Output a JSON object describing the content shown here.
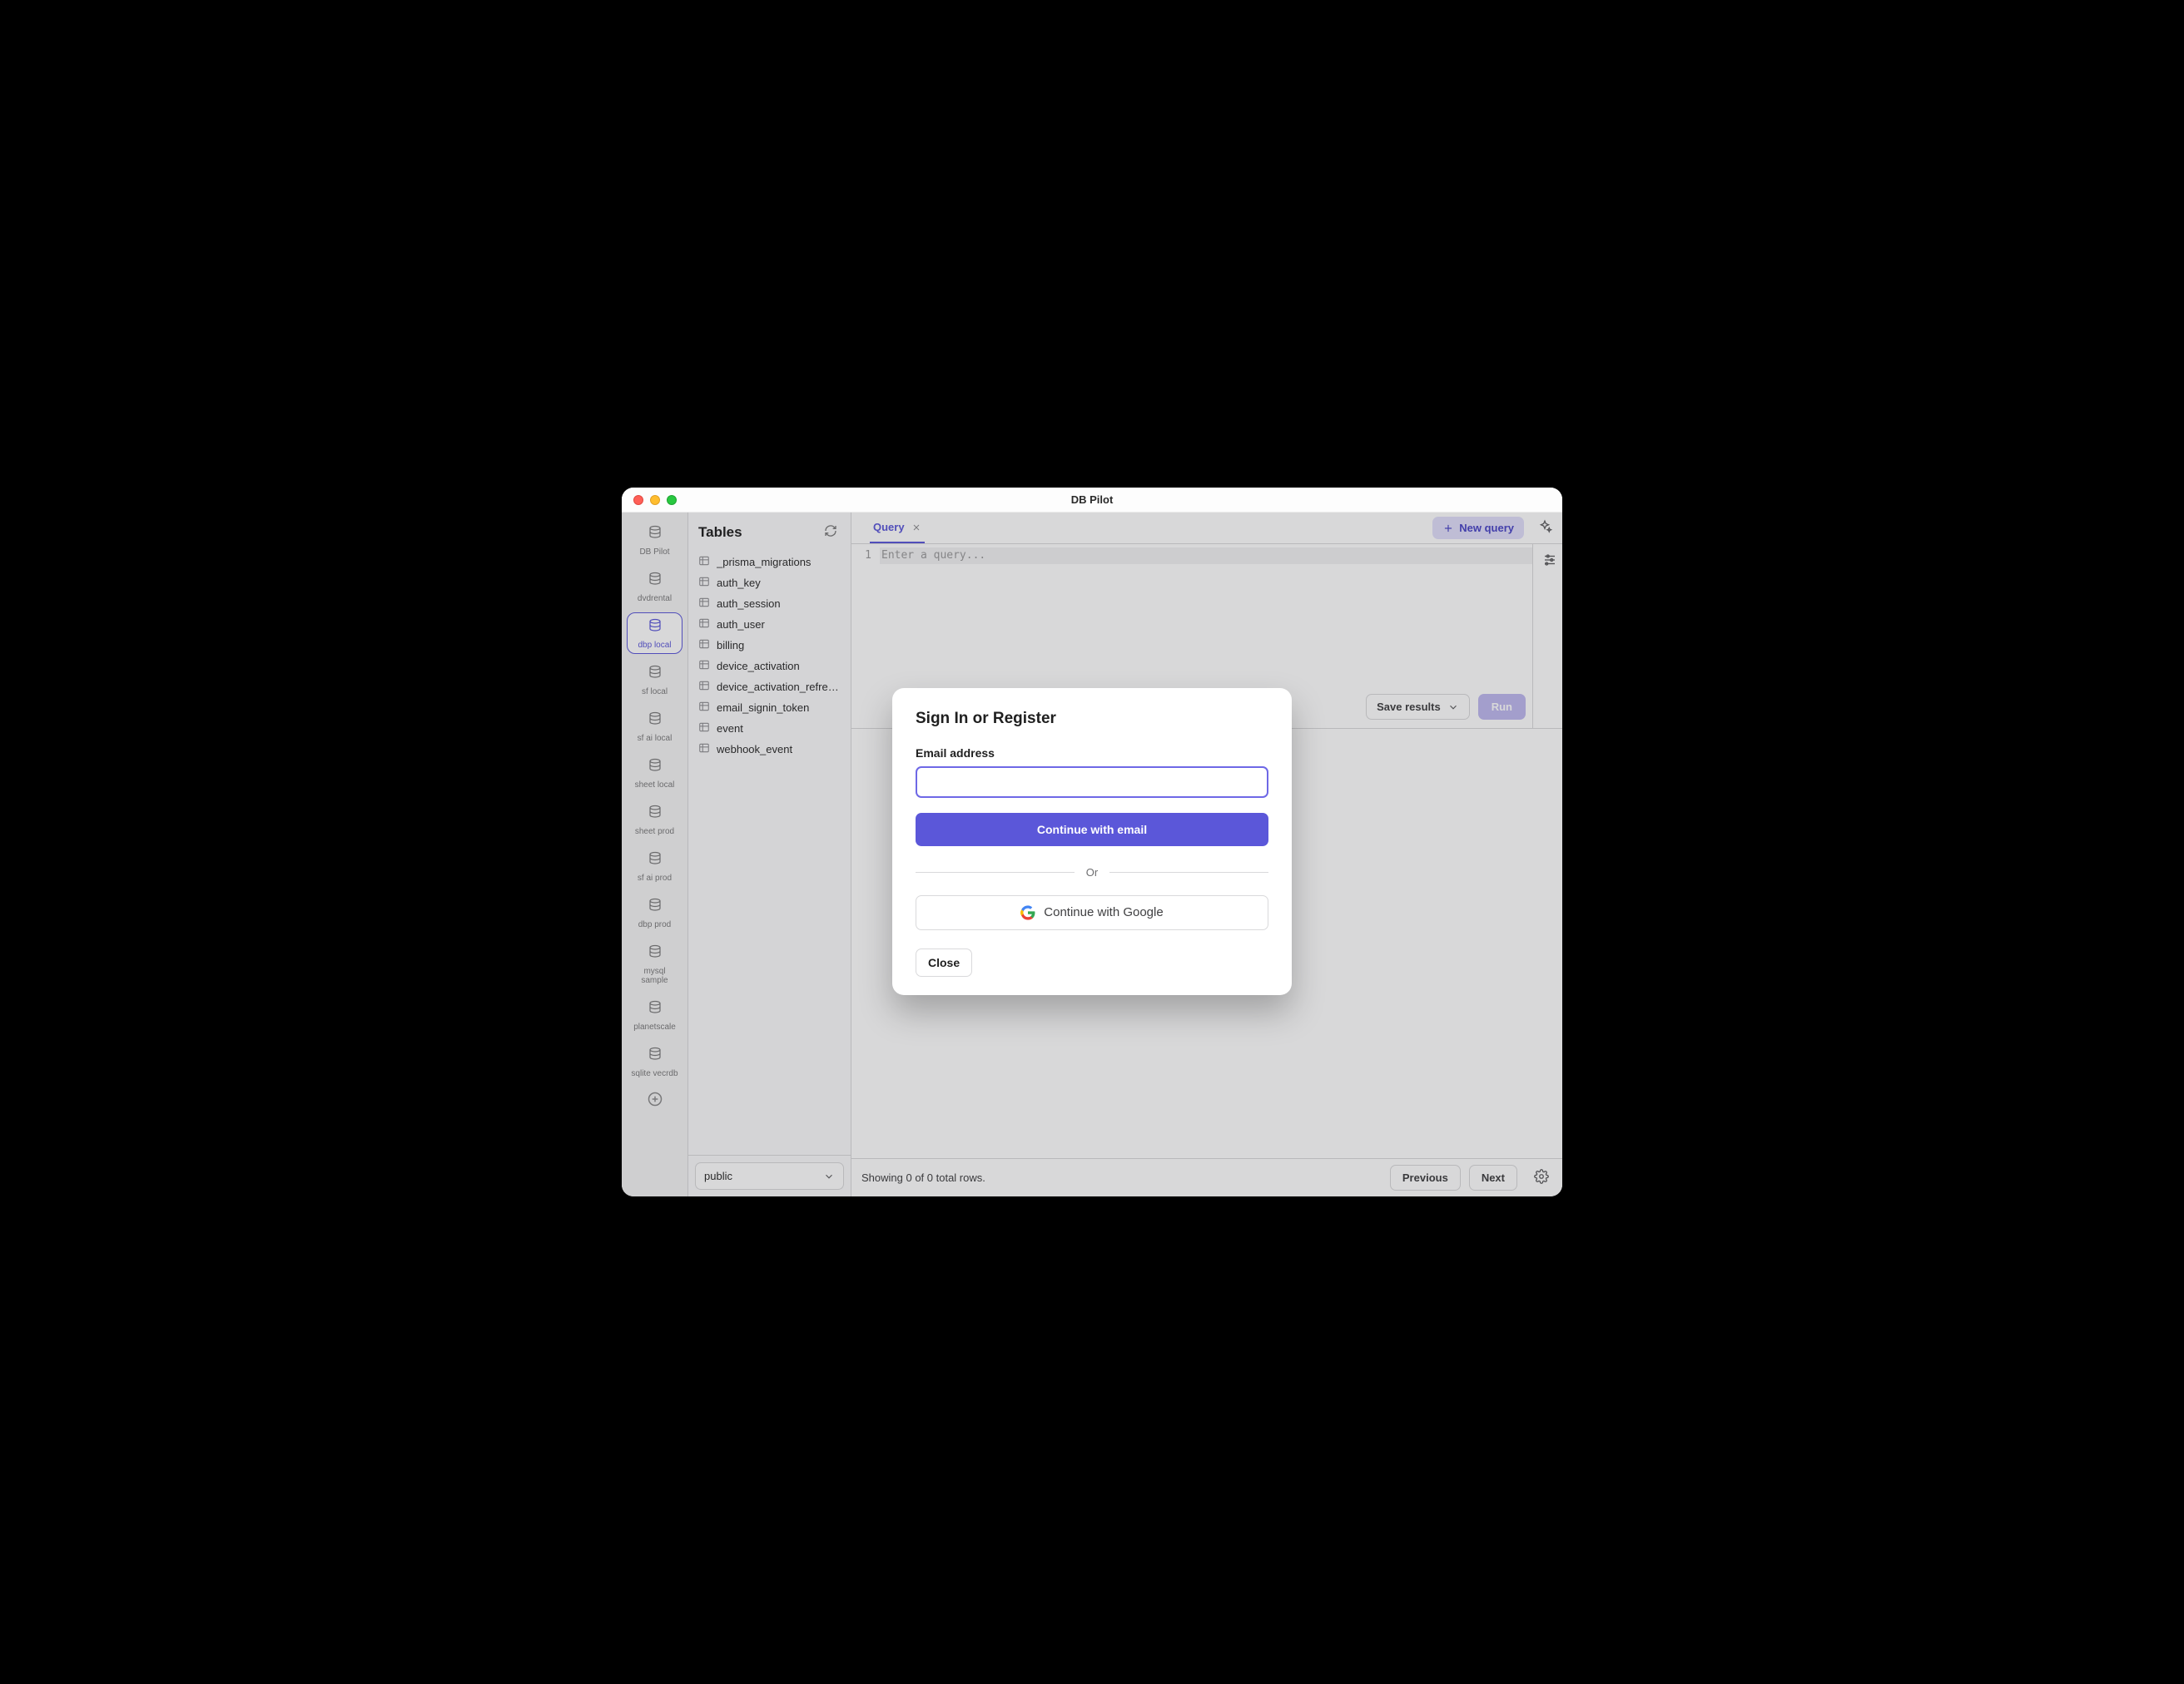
{
  "window": {
    "title": "DB Pilot"
  },
  "rail": {
    "items": [
      {
        "label": "DB Pilot",
        "active": false
      },
      {
        "label": "dvdrental",
        "active": false
      },
      {
        "label": "dbp local",
        "active": true
      },
      {
        "label": "sf local",
        "active": false
      },
      {
        "label": "sf ai local",
        "active": false
      },
      {
        "label": "sheet local",
        "active": false
      },
      {
        "label": "sheet prod",
        "active": false
      },
      {
        "label": "sf ai prod",
        "active": false
      },
      {
        "label": "dbp prod",
        "active": false
      },
      {
        "label": "mysql sample",
        "active": false
      },
      {
        "label": "planetscale",
        "active": false
      },
      {
        "label": "sqlite vecrdb",
        "active": false
      }
    ]
  },
  "sidebar": {
    "heading": "Tables",
    "tables": [
      "_prisma_migrations",
      "auth_key",
      "auth_session",
      "auth_user",
      "billing",
      "device_activation",
      "device_activation_refresh…",
      "email_signin_token",
      "event",
      "webhook_event"
    ],
    "schema_selected": "public"
  },
  "tabs": {
    "active_label": "Query",
    "new_query_label": "New query"
  },
  "editor": {
    "line_number": "1",
    "placeholder": "Enter a query..."
  },
  "actions": {
    "save_results_label": "Save results",
    "run_label": "Run"
  },
  "footer": {
    "status": "Showing 0 of 0 total rows.",
    "prev_label": "Previous",
    "next_label": "Next"
  },
  "modal": {
    "title": "Sign In or Register",
    "email_label": "Email address",
    "email_value": "",
    "continue_email": "Continue with email",
    "or": "Or",
    "continue_google": "Continue with Google",
    "close": "Close"
  }
}
